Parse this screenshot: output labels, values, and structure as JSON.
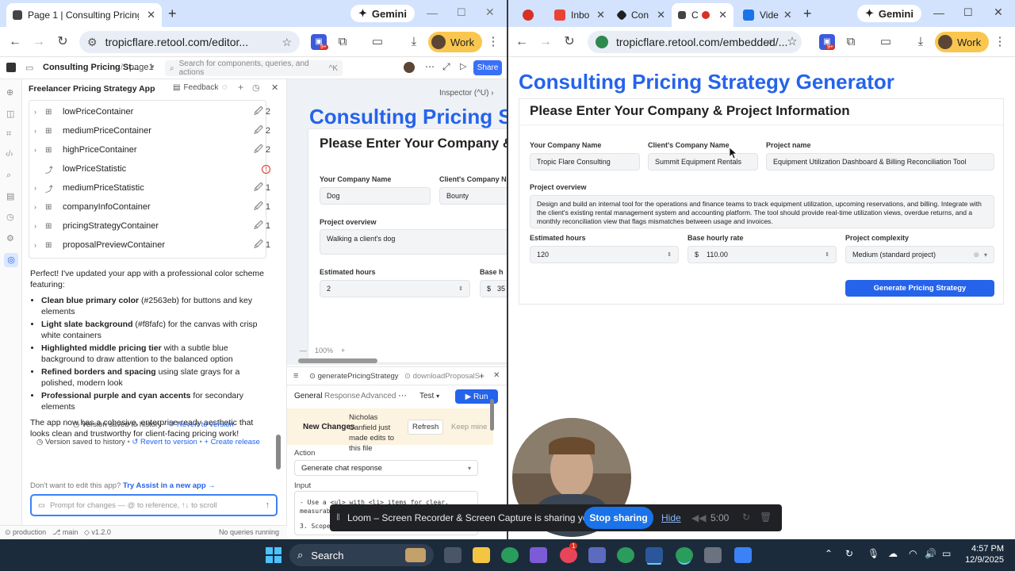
{
  "left_browser": {
    "tab_title": "Page 1 | Consulting Pricing Stra",
    "new_tab": "+",
    "gemini_label": "Gemini",
    "address": "tropicflare.retool.com/editor...",
    "work_label": "Work",
    "ext_badge": "9+"
  },
  "right_browser": {
    "tabs": [
      {
        "label": "",
        "color": "#d93025"
      },
      {
        "label": "Inbo",
        "color": "#ea4335"
      },
      {
        "label": "Con",
        "color": "#1f1f1f"
      },
      {
        "label": "C",
        "color": "#1f1f1f"
      },
      {
        "label": "Vide",
        "color": "#1a73e8"
      }
    ],
    "new_tab": "+",
    "gemini_label": "Gemini",
    "address": "tropicflare.retool.com/embedded/...",
    "work_label": "Work",
    "ext_badge": "9+"
  },
  "retool": {
    "app_name": "Consulting Pricing St...",
    "page": "page1",
    "search_placeholder": "Search for components, queries, and actions",
    "search_shortcut": "^K",
    "share": "Share",
    "panel_title": "Freelancer Pricing Strategy App",
    "feedback": "Feedback",
    "tree": [
      {
        "name": "lowPriceContainer",
        "count": "2",
        "expandable": true
      },
      {
        "name": "mediumPriceContainer",
        "count": "2",
        "expandable": true
      },
      {
        "name": "highPriceContainer",
        "count": "2",
        "expandable": true
      },
      {
        "name": "lowPriceStatistic",
        "count": "!",
        "expandable": false
      },
      {
        "name": "mediumPriceStatistic",
        "count": "1",
        "expandable": true
      },
      {
        "name": "companyInfoContainer",
        "count": "1",
        "expandable": true
      },
      {
        "name": "pricingStrategyContainer",
        "count": "1",
        "expandable": true
      },
      {
        "name": "proposalPreviewContainer",
        "count": "1",
        "expandable": true
      }
    ],
    "chat_intro": "Perfect! I've updated your app with a professional color scheme featuring:",
    "chat_items": [
      {
        "bold": "Clean blue primary color",
        "rest": " (#2563eb) for buttons and key elements"
      },
      {
        "bold": "Light slate background",
        "rest": " (#f8fafc) for the canvas with crisp white containers"
      },
      {
        "bold": "Highlighted middle pricing tier",
        "rest": " with a subtle blue background to draw attention to the balanced option"
      },
      {
        "bold": "Refined borders and spacing",
        "rest": " using slate grays for a polished, modern look"
      },
      {
        "bold": "Professional purple and cyan accents",
        "rest": " for secondary elements"
      }
    ],
    "chat_outro": "The app now has a cohesive, enterprise-ready aesthetic that looks clean and trustworthy for client-facing pricing work!",
    "version_saved": "Version saved to history",
    "revert": "Revert to version",
    "create_release": "Create release",
    "dont_edit": "Don't want to edit this app?",
    "try_assist": "Try Assist in a new app →",
    "prompt_placeholder": "Prompt for changes — @ to reference, ↑↓ to scroll",
    "status_env": "production",
    "status_branch": "main",
    "status_version": "v1.2.0",
    "status_queries": "No queries running",
    "inspector": "Inspector (^U)",
    "canvas_title": "Consulting Pricing St",
    "canvas_subtitle": "Please Enter Your Company & P",
    "canvas_company_label": "Your Company Name",
    "canvas_company_value": "Dog",
    "canvas_client_label": "Client's Company Name",
    "canvas_client_value": "Bounty",
    "canvas_overview_label": "Project overview",
    "canvas_overview_value": "Walking a client's dog",
    "canvas_hours_label": "Estimated hours",
    "canvas_hours_value": "2",
    "canvas_rate_label": "Base h",
    "canvas_rate_value": "35",
    "zoom": "100%",
    "query_tab1": "generatePricingStrategy",
    "query_tab2": "downloadProposalS",
    "subtab_general": "General",
    "subtab_response": "Response",
    "subtab_advanced": "Advanced",
    "test": "Test",
    "run": "Run",
    "new_changes": "New Changes",
    "new_changes_msg": "Nicholas Canfield just made edits to this file",
    "refresh": "Refresh",
    "keep_mine": "Keep mine",
    "action_label": "Action",
    "action_value": "Generate chat response",
    "input_label": "Input",
    "code_line1": "- Use a <ul> with <li> items for clear,",
    "code_line2": "measurable",
    "code_line3": "3. Scope"
  },
  "app": {
    "title": "Consulting Pricing Strategy Generator",
    "subtitle": "Please Enter Your Company & Project Information",
    "company_label": "Your Company Name",
    "company_value": "Tropic Flare Consulting",
    "client_label": "Client's Company Name",
    "client_value": "Summit Equipment Rentals",
    "project_label": "Project name",
    "project_value": "Equipment Utilization Dashboard & Billing Reconciliation Tool",
    "overview_label": "Project overview",
    "overview_value": "Design and build an internal tool for the operations and finance teams to track equipment utilization, upcoming reservations, and billing. Integrate with the client's existing rental management system and accounting platform. The tool should provide real-time utilization views, overdue returns, and a monthly reconciliation view that flags mismatches between usage and invoices.",
    "hours_label": "Estimated hours",
    "hours_value": "120",
    "rate_label": "Base hourly rate",
    "rate_prefix": "$",
    "rate_value": "110.00",
    "complexity_label": "Project complexity",
    "complexity_value": "Medium (standard project)",
    "generate_button": "Generate Pricing Strategy"
  },
  "loom": {
    "message": "Loom – Screen Recorder & Screen Capture is sharing your screen.",
    "stop": "Stop sharing",
    "hide": "Hide",
    "timer": "5:00"
  },
  "taskbar": {
    "search": "Search",
    "time": "4:57 PM",
    "date": "12/9/2025",
    "notif_badge": "1"
  }
}
